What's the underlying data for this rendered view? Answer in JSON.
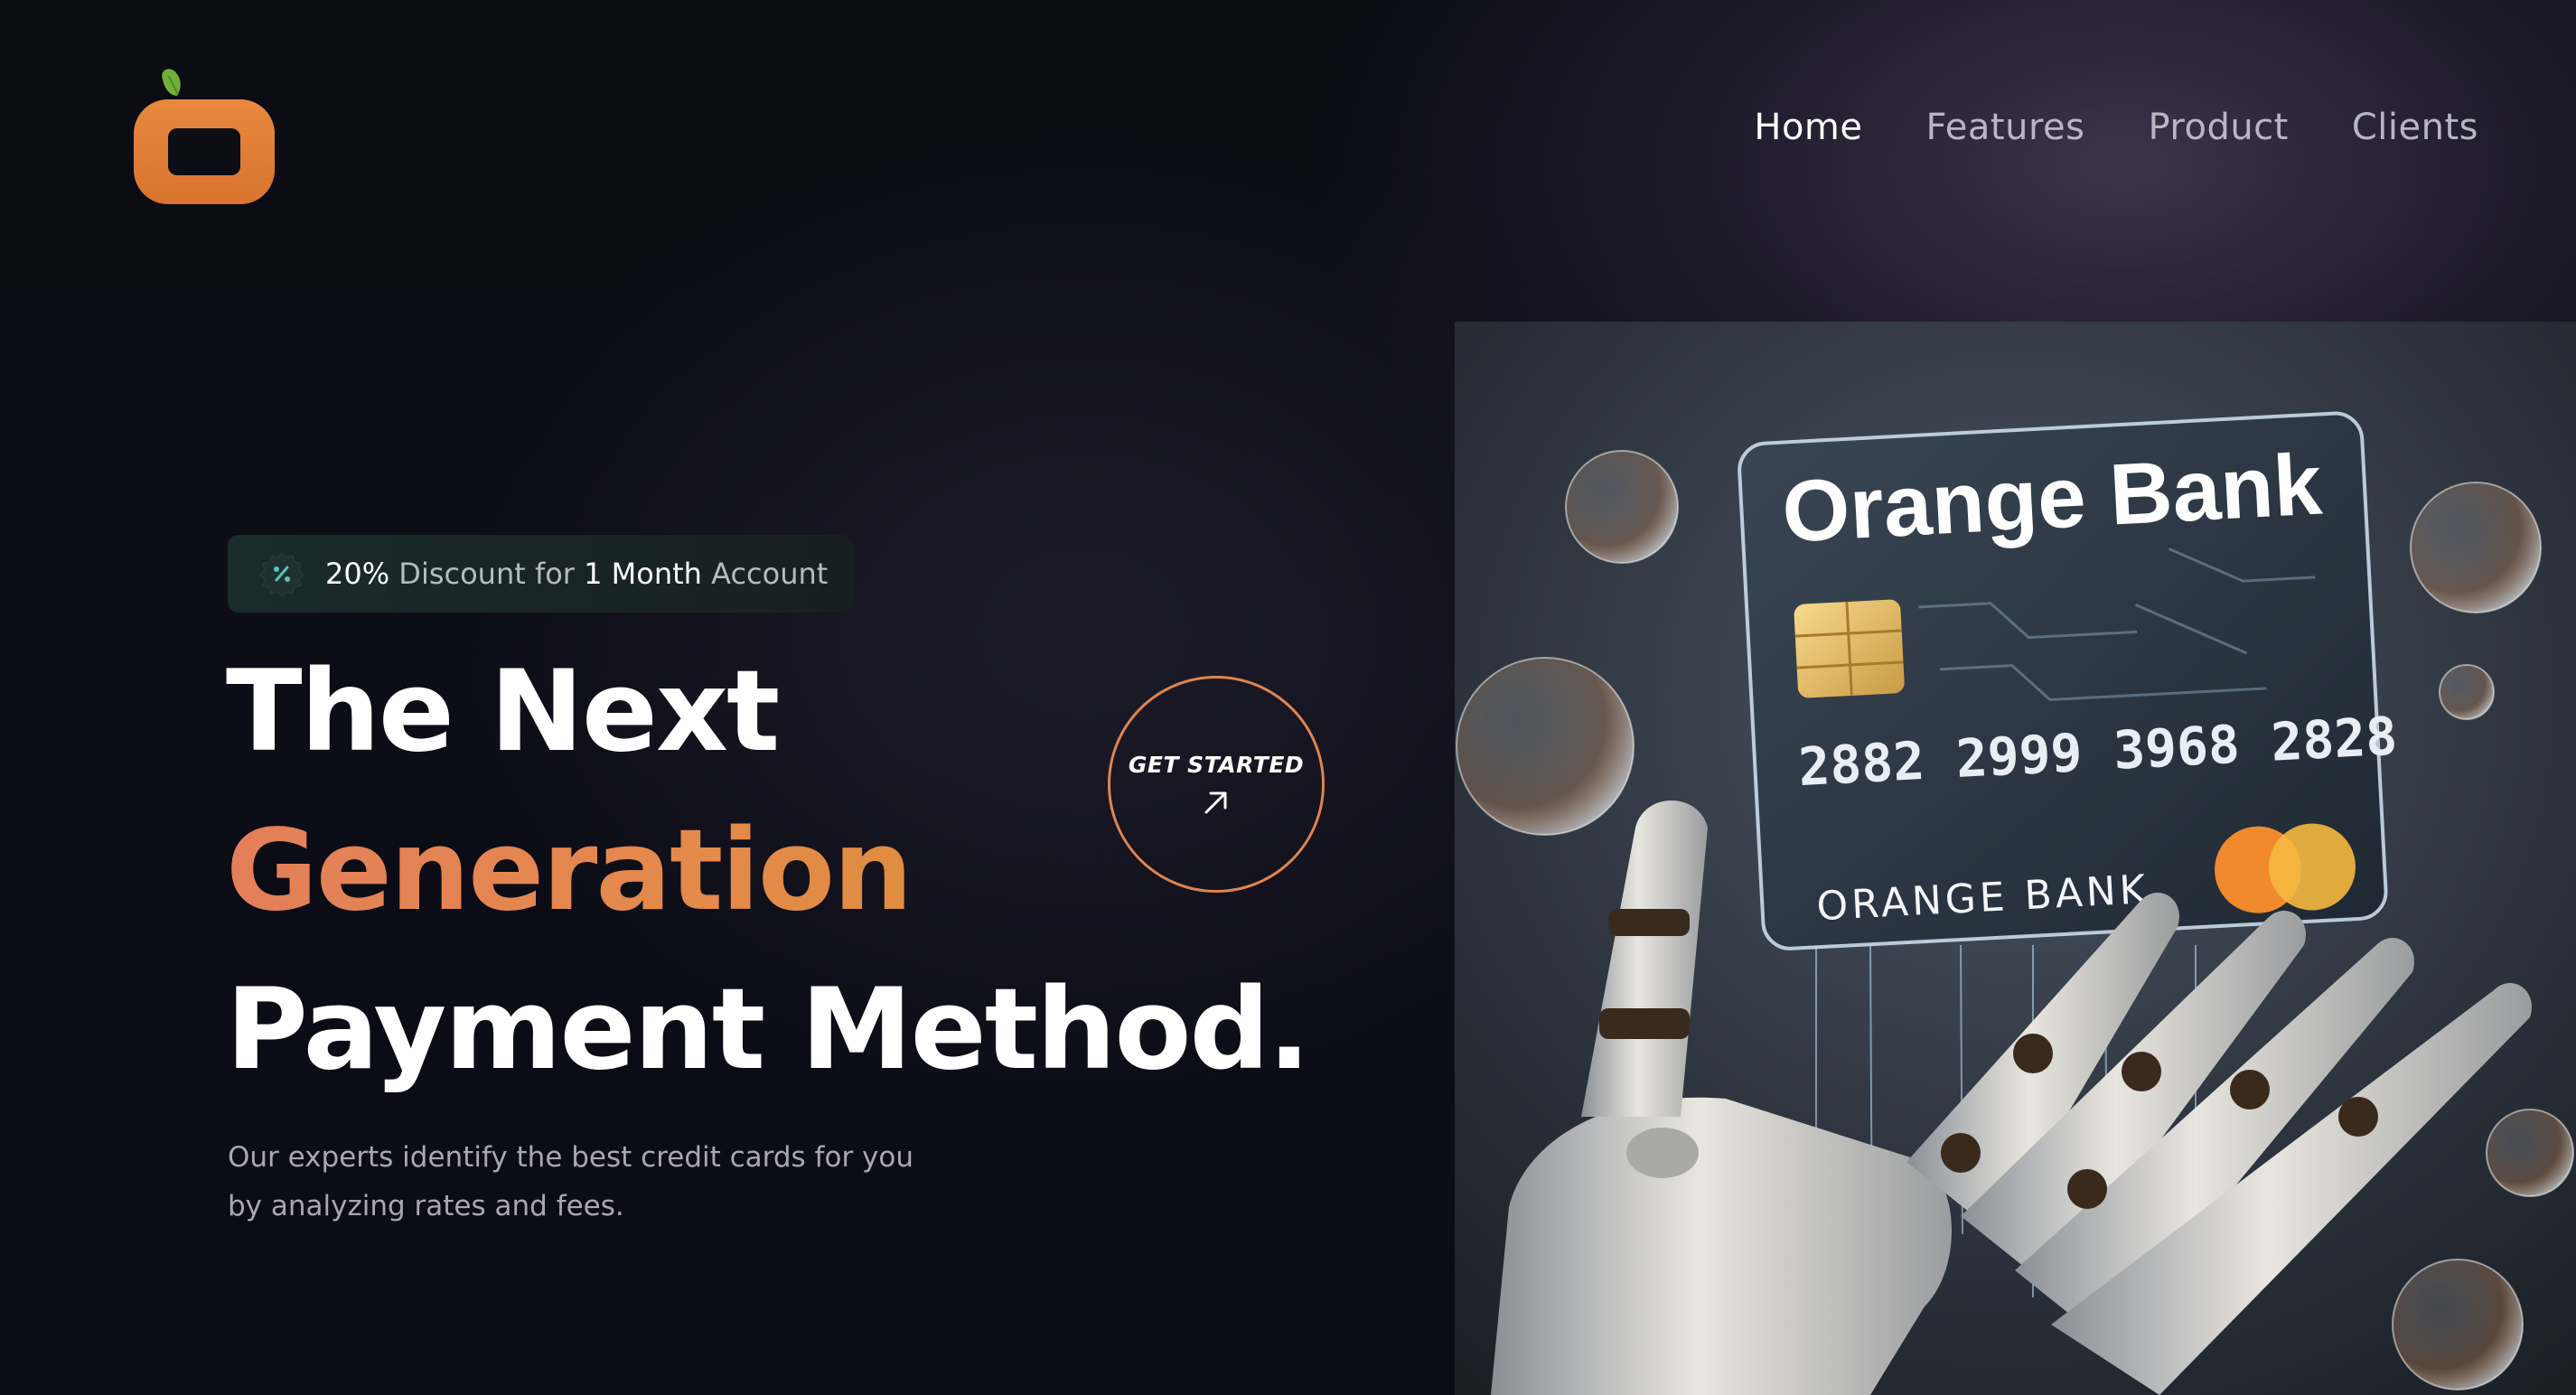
{
  "brand": {
    "logo_icon": "orange-fruit-logo",
    "primary_color": "#e37f3f",
    "leaf_color": "#6fb03a"
  },
  "nav": {
    "items": [
      {
        "label": "Home",
        "active": true
      },
      {
        "label": "Features",
        "active": false
      },
      {
        "label": "Product",
        "active": false
      },
      {
        "label": "Clients",
        "active": false
      }
    ]
  },
  "hero": {
    "promo": {
      "icon": "percent-badge-icon",
      "percent": "20%",
      "text_1": "Discount for",
      "highlight": "1 Month",
      "text_2": "Account"
    },
    "headline": {
      "line1": "The Next",
      "line2": "Generation",
      "line3": "Payment Method."
    },
    "description": "Our experts identify the best credit cards for you by analyzing rates and fees.",
    "cta": {
      "label": "GET STARTED",
      "icon": "arrow-up-right-icon"
    },
    "image": {
      "card_title": "Orange Bank",
      "card_number": "2882 2999 3968 2828",
      "card_name": "ORANGE BANK",
      "accent_color": "#f0a040"
    }
  }
}
